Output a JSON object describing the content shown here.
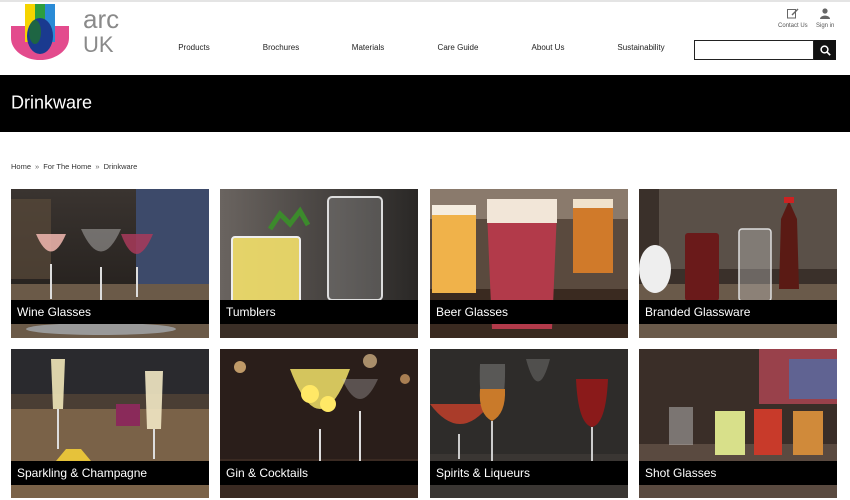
{
  "brand": {
    "line1": "arc",
    "line2": "UK"
  },
  "nav": [
    {
      "label": "Products"
    },
    {
      "label": "Brochures"
    },
    {
      "label": "Materials"
    },
    {
      "label": "Care Guide"
    },
    {
      "label": "About Us"
    },
    {
      "label": "Sustainability"
    }
  ],
  "utility": {
    "contact": {
      "label": "Contact Us",
      "icon": "edit-icon"
    },
    "signin": {
      "label": "Sign in",
      "icon": "user-icon"
    }
  },
  "search": {
    "placeholder": "",
    "value": "",
    "icon": "search-icon"
  },
  "page": {
    "title": "Drinkware"
  },
  "breadcrumb": [
    "Home",
    "For The Home",
    "Drinkware"
  ],
  "categories": [
    {
      "label": "Wine Glasses"
    },
    {
      "label": "Tumblers"
    },
    {
      "label": "Beer Glasses"
    },
    {
      "label": "Branded Glassware"
    },
    {
      "label": "Sparkling & Champagne"
    },
    {
      "label": "Gin & Cocktails"
    },
    {
      "label": "Spirits & Liqueurs"
    },
    {
      "label": "Shot Glasses"
    }
  ],
  "colors": {
    "banner": "#000000",
    "caption_bg": "#000000",
    "caption_text": "#ffffff",
    "logo_text": "#8a8a8a"
  }
}
